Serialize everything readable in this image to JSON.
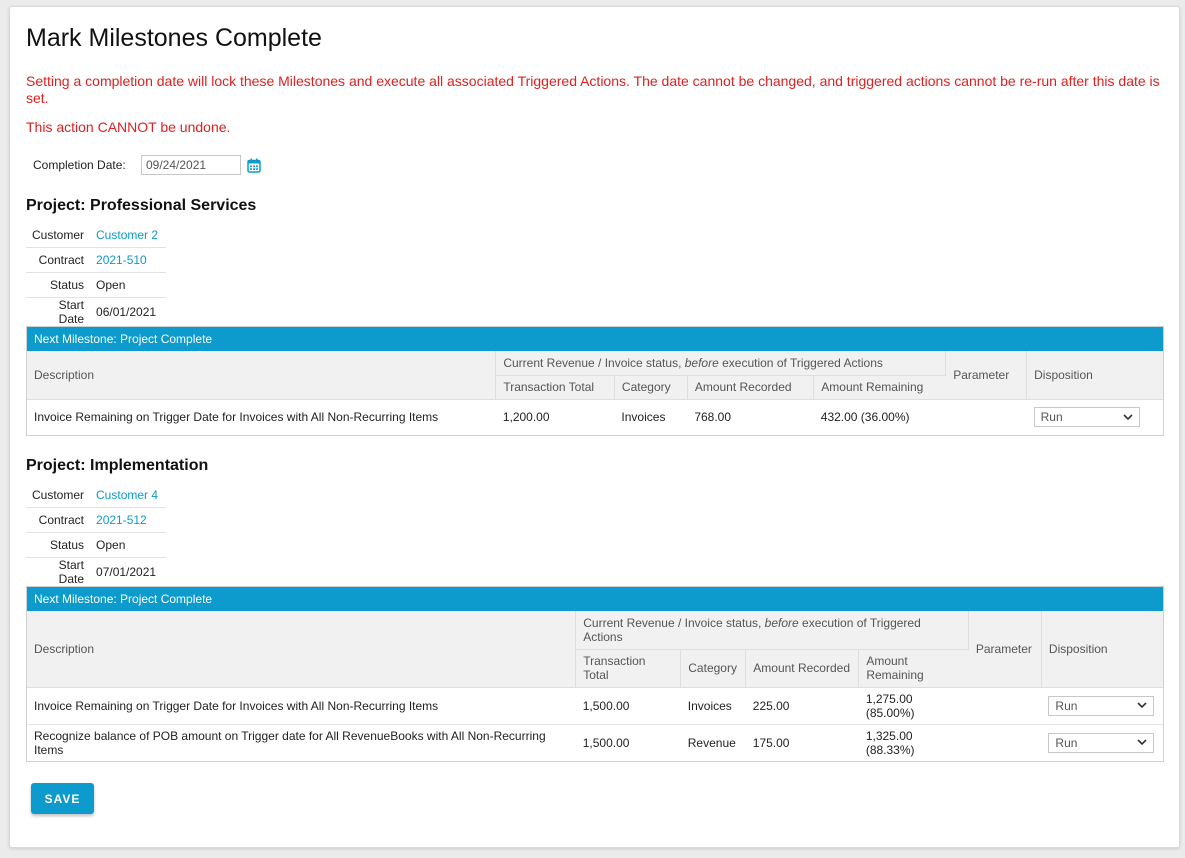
{
  "page": {
    "title": "Mark Milestones Complete",
    "warning_1": "Setting a completion date will lock these Milestones and execute all associated Triggered Actions. The date cannot be changed, and triggered actions cannot be re-run after this date is set.",
    "warning_2": "This action CANNOT be undone.",
    "completion_date_label": "Completion Date:",
    "completion_date_value": "09/24/2021",
    "save_label": "SAVE",
    "accent_color": "#0c9bcc",
    "warning_color": "#e02020"
  },
  "columns": {
    "description": "Description",
    "group_prefix": "Current Revenue / Invoice status, ",
    "group_em": "before",
    "group_suffix": " execution of Triggered Actions",
    "transaction_total": "Transaction Total",
    "category": "Category",
    "amount_recorded": "Amount Recorded",
    "amount_remaining": "Amount Remaining",
    "parameter": "Parameter",
    "disposition": "Disposition"
  },
  "labels": {
    "customer": "Customer",
    "contract": "Contract",
    "status": "Status",
    "start_date": "Start Date"
  },
  "projects": [
    {
      "heading": "Project: Professional Services",
      "customer": "Customer 2",
      "contract": "2021-510",
      "status": "Open",
      "start_date": "06/01/2021",
      "milestone": "Next Milestone: Project Complete",
      "rows": [
        {
          "description": "Invoice Remaining on Trigger Date for Invoices with All Non-Recurring Items",
          "transaction_total": "1,200.00",
          "category": "Invoices",
          "amount_recorded": "768.00",
          "amount_remaining": "432.00 (36.00%)",
          "parameter": "",
          "disposition": "Run"
        }
      ]
    },
    {
      "heading": "Project: Implementation",
      "customer": "Customer 4",
      "contract": "2021-512",
      "status": "Open",
      "start_date": "07/01/2021",
      "milestone": "Next Milestone: Project Complete",
      "rows": [
        {
          "description": "Invoice Remaining on Trigger Date for Invoices with All Non-Recurring Items",
          "transaction_total": "1,500.00",
          "category": "Invoices",
          "amount_recorded": "225.00",
          "amount_remaining": "1,275.00 (85.00%)",
          "parameter": "",
          "disposition": "Run"
        },
        {
          "description": "Recognize balance of POB amount on Trigger date for All RevenueBooks with All Non-Recurring Items",
          "transaction_total": "1,500.00",
          "category": "Revenue",
          "amount_recorded": "175.00",
          "amount_remaining": "1,325.00 (88.33%)",
          "parameter": "",
          "disposition": "Run"
        }
      ]
    }
  ]
}
